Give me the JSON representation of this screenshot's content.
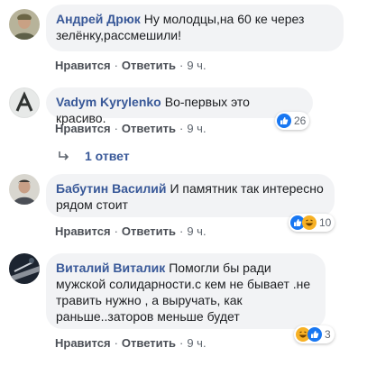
{
  "actions": {
    "like": "Нравится",
    "reply": "Ответить",
    "separator": "·"
  },
  "comments": [
    {
      "author": "Андрей Дрюк",
      "text": "Ну молодцы,на 60 ке через зелёнку,рассмешили!",
      "time": "9 ч.",
      "reactions": null
    },
    {
      "author": "Vadym Kyrylenko",
      "text": "Во-первых это красиво.",
      "time": "9 ч.",
      "reactions": {
        "icons": [
          "like-icon"
        ],
        "count": "26"
      }
    },
    {
      "author": "Бабутин Василий",
      "text": "И памятник так интересно рядом стоит",
      "time": "9 ч.",
      "reactions": {
        "icons": [
          "like-icon",
          "haha-icon"
        ],
        "count": "10"
      }
    },
    {
      "author": "Виталий Виталик",
      "text": "Помогли бы ради мужской солидарности.с кем не бывает .не травить нужно , а выручать, как раньше..заторов меньше будет",
      "time": "9 ч.",
      "reactions": {
        "icons": [
          "haha-icon",
          "like-icon"
        ],
        "count": "3"
      }
    }
  ],
  "replies_link": "1 ответ",
  "colors": {
    "link": "#385898",
    "bubble": "#f2f3f5",
    "like": "#1877f2",
    "haha": "#f7b125"
  }
}
